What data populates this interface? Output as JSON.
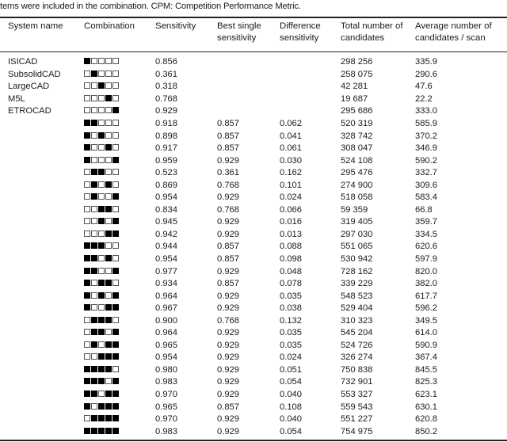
{
  "caption": "tems were included in the combination. CPM: Competition Performance Metric.",
  "headers": {
    "system_name": "System name",
    "combination": "Combination",
    "sensitivity": "Sensitivity",
    "best_single_sensitivity": "Best single sensitivity",
    "difference_sensitivity": "Difference sensitivity",
    "total_candidates": "Total number of candidates",
    "avg_candidates": "Average number of candidates / scan"
  },
  "rows": [
    {
      "name": "ISICAD",
      "combo": [
        1,
        0,
        0,
        0,
        0
      ],
      "sens": "0.856",
      "best": "",
      "diff": "",
      "total": "298 256",
      "avg": "335.9"
    },
    {
      "name": "SubsolidCAD",
      "combo": [
        0,
        1,
        0,
        0,
        0
      ],
      "sens": "0.361",
      "best": "",
      "diff": "",
      "total": "258 075",
      "avg": "290.6"
    },
    {
      "name": "LargeCAD",
      "combo": [
        0,
        0,
        1,
        0,
        0
      ],
      "sens": "0.318",
      "best": "",
      "diff": "",
      "total": "42 281",
      "avg": "47.6"
    },
    {
      "name": "M5L",
      "combo": [
        0,
        0,
        0,
        1,
        0
      ],
      "sens": "0.768",
      "best": "",
      "diff": "",
      "total": "19 687",
      "avg": "22.2"
    },
    {
      "name": "ETROCAD",
      "combo": [
        0,
        0,
        0,
        0,
        1
      ],
      "sens": "0.929",
      "best": "",
      "diff": "",
      "total": "295 686",
      "avg": "333.0"
    },
    {
      "name": "",
      "combo": [
        1,
        1,
        0,
        0,
        0
      ],
      "sens": "0.918",
      "best": "0.857",
      "diff": "0.062",
      "total": "520 319",
      "avg": "585.9"
    },
    {
      "name": "",
      "combo": [
        1,
        0,
        1,
        0,
        0
      ],
      "sens": "0.898",
      "best": "0.857",
      "diff": "0.041",
      "total": "328 742",
      "avg": "370.2"
    },
    {
      "name": "",
      "combo": [
        1,
        0,
        0,
        1,
        0
      ],
      "sens": "0.917",
      "best": "0.857",
      "diff": "0.061",
      "total": "308 047",
      "avg": "346.9"
    },
    {
      "name": "",
      "combo": [
        1,
        0,
        0,
        0,
        1
      ],
      "sens": "0.959",
      "best": "0.929",
      "diff": "0.030",
      "total": "524 108",
      "avg": "590.2"
    },
    {
      "name": "",
      "combo": [
        0,
        1,
        1,
        0,
        0
      ],
      "sens": "0.523",
      "best": "0.361",
      "diff": "0.162",
      "total": "295 476",
      "avg": "332.7"
    },
    {
      "name": "",
      "combo": [
        0,
        1,
        0,
        1,
        0
      ],
      "sens": "0.869",
      "best": "0.768",
      "diff": "0.101",
      "total": "274 900",
      "avg": "309.6"
    },
    {
      "name": "",
      "combo": [
        0,
        1,
        0,
        0,
        1
      ],
      "sens": "0.954",
      "best": "0.929",
      "diff": "0.024",
      "total": "518 058",
      "avg": "583.4"
    },
    {
      "name": "",
      "combo": [
        0,
        0,
        1,
        1,
        0
      ],
      "sens": "0.834",
      "best": "0.768",
      "diff": "0.066",
      "total": "59 359",
      "avg": "66.8"
    },
    {
      "name": "",
      "combo": [
        0,
        0,
        1,
        0,
        1
      ],
      "sens": "0.945",
      "best": "0.929",
      "diff": "0.016",
      "total": "319 405",
      "avg": "359.7"
    },
    {
      "name": "",
      "combo": [
        0,
        0,
        0,
        1,
        1
      ],
      "sens": "0.942",
      "best": "0.929",
      "diff": "0.013",
      "total": "297 030",
      "avg": "334.5"
    },
    {
      "name": "",
      "combo": [
        1,
        1,
        1,
        0,
        0
      ],
      "sens": "0.944",
      "best": "0.857",
      "diff": "0.088",
      "total": "551 065",
      "avg": "620.6"
    },
    {
      "name": "",
      "combo": [
        1,
        1,
        0,
        1,
        0
      ],
      "sens": "0.954",
      "best": "0.857",
      "diff": "0.098",
      "total": "530 942",
      "avg": "597.9"
    },
    {
      "name": "",
      "combo": [
        1,
        1,
        0,
        0,
        1
      ],
      "sens": "0.977",
      "best": "0.929",
      "diff": "0.048",
      "total": "728 162",
      "avg": "820.0"
    },
    {
      "name": "",
      "combo": [
        1,
        0,
        1,
        1,
        0
      ],
      "sens": "0.934",
      "best": "0.857",
      "diff": "0.078",
      "total": "339 229",
      "avg": "382.0"
    },
    {
      "name": "",
      "combo": [
        1,
        0,
        1,
        0,
        1
      ],
      "sens": "0.964",
      "best": "0.929",
      "diff": "0.035",
      "total": "548 523",
      "avg": "617.7"
    },
    {
      "name": "",
      "combo": [
        1,
        0,
        0,
        1,
        1
      ],
      "sens": "0.967",
      "best": "0.929",
      "diff": "0.038",
      "total": "529 404",
      "avg": "596.2"
    },
    {
      "name": "",
      "combo": [
        0,
        1,
        1,
        1,
        0
      ],
      "sens": "0.900",
      "best": "0.768",
      "diff": "0.132",
      "total": "310 323",
      "avg": "349.5"
    },
    {
      "name": "",
      "combo": [
        0,
        1,
        1,
        0,
        1
      ],
      "sens": "0.964",
      "best": "0.929",
      "diff": "0.035",
      "total": "545 204",
      "avg": "614.0"
    },
    {
      "name": "",
      "combo": [
        0,
        1,
        0,
        1,
        1
      ],
      "sens": "0.965",
      "best": "0.929",
      "diff": "0.035",
      "total": "524 726",
      "avg": "590.9"
    },
    {
      "name": "",
      "combo": [
        0,
        0,
        1,
        1,
        1
      ],
      "sens": "0.954",
      "best": "0.929",
      "diff": "0.024",
      "total": "326 274",
      "avg": "367.4"
    },
    {
      "name": "",
      "combo": [
        1,
        1,
        1,
        1,
        0
      ],
      "sens": "0.980",
      "best": "0.929",
      "diff": "0.051",
      "total": "750 838",
      "avg": "845.5"
    },
    {
      "name": "",
      "combo": [
        1,
        1,
        1,
        0,
        1
      ],
      "sens": "0.983",
      "best": "0.929",
      "diff": "0.054",
      "total": "732 901",
      "avg": "825.3"
    },
    {
      "name": "",
      "combo": [
        1,
        1,
        0,
        1,
        1
      ],
      "sens": "0.970",
      "best": "0.929",
      "diff": "0.040",
      "total": "553 327",
      "avg": "623.1"
    },
    {
      "name": "",
      "combo": [
        1,
        0,
        1,
        1,
        1
      ],
      "sens": "0.965",
      "best": "0.857",
      "diff": "0.108",
      "total": "559 543",
      "avg": "630.1"
    },
    {
      "name": "",
      "combo": [
        0,
        1,
        1,
        1,
        1
      ],
      "sens": "0.970",
      "best": "0.929",
      "diff": "0.040",
      "total": "551 227",
      "avg": "620.8"
    },
    {
      "name": "",
      "combo": [
        1,
        1,
        1,
        1,
        1
      ],
      "sens": "0.983",
      "best": "0.929",
      "diff": "0.054",
      "total": "754 975",
      "avg": "850.2"
    }
  ]
}
